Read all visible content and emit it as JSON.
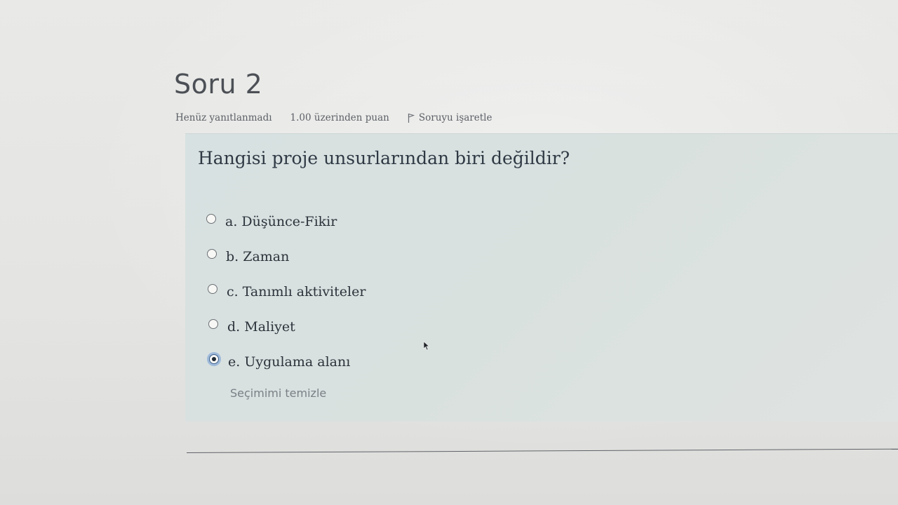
{
  "question": {
    "title": "Soru 2",
    "status": "Henüz yanıtlanmadı",
    "points": "1.00 üzerinden puan",
    "flag_label": "Soruyu işaretle",
    "text": "Hangisi proje unsurlarından biri değildir?",
    "answers": [
      {
        "label": "a. Düşünce-Fikir",
        "selected": false
      },
      {
        "label": "b. Zaman",
        "selected": false
      },
      {
        "label": "c. Tanımlı aktiviteler",
        "selected": false
      },
      {
        "label": "d. Maliyet",
        "selected": false
      },
      {
        "label": "e. Uygulama alanı",
        "selected": true
      }
    ],
    "clear_choice_label": "Seçimimi temizle"
  },
  "icons": {
    "flag": "flag-icon",
    "cursor": "mouse-pointer-icon"
  },
  "colors": {
    "question_box": "#d9e1df",
    "selected_radio_ring": "#5a8cd2"
  }
}
